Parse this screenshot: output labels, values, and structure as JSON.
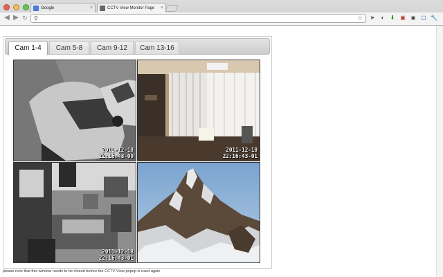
{
  "browser": {
    "tabs": [
      {
        "label": "Google",
        "favicon_color": "#4a7cd8"
      },
      {
        "label": "CCTV View Monitor Page",
        "favicon_color": "#666666"
      }
    ],
    "address": "",
    "close_glyph": "×"
  },
  "page": {
    "tabs": [
      "Cam 1-4",
      "Cam 5-8",
      "Cam 9-12",
      "Cam 13-16"
    ],
    "active_tab": "Cam 1-4",
    "cameras": [
      {
        "id": "cam-1",
        "date": "2011-12-18",
        "time": "22:16:48-00"
      },
      {
        "id": "cam-2",
        "date": "2011-12-18",
        "time": "22:16:43-01"
      },
      {
        "id": "cam-3",
        "date": "2011-12-18",
        "time": "22:16:43-01"
      },
      {
        "id": "cam-4"
      }
    ],
    "note": "please note that this window needs to be closed before the CCTV View popup is used again"
  },
  "colors": {
    "chrome": "#d6d6d6",
    "accent": "#4a7cd8"
  }
}
